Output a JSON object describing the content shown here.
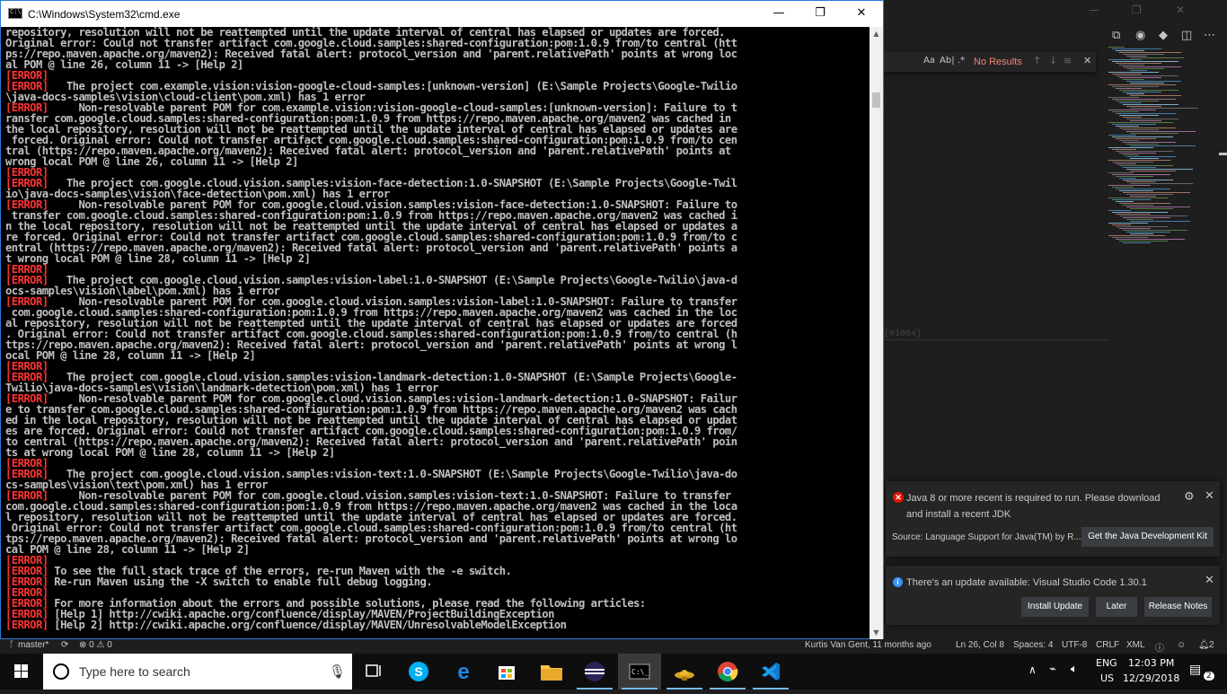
{
  "cmd": {
    "title": "C:\\Windows\\System32\\cmd.exe",
    "minimize": "—",
    "maximize": "❐",
    "close": "✕",
    "lines": [
      {
        "e": "",
        "t": "repository, resolution will not be reattempted until the update interval of central has elapsed or updates are forced."
      },
      {
        "e": "",
        "t": "Original error: Could not transfer artifact com.google.cloud.samples:shared-configuration:pom:1.0.9 from/to central (htt"
      },
      {
        "e": "",
        "t": "ps://repo.maven.apache.org/maven2): Received fatal alert: protocol_version and 'parent.relativePath' points at wrong loc"
      },
      {
        "e": "",
        "t": "al POM @ line 26, column 11 -> [Help 2]"
      },
      {
        "e": "[ERROR]",
        "t": ""
      },
      {
        "e": "[ERROR]",
        "t": "   The project com.example.vision:vision-google-cloud-samples:[unknown-version] (E:\\Sample Projects\\Google-Twilio"
      },
      {
        "e": "",
        "t": "\\java-docs-samples\\vision\\cloud-client\\pom.xml) has 1 error"
      },
      {
        "e": "[ERROR]",
        "t": "     Non-resolvable parent POM for com.example.vision:vision-google-cloud-samples:[unknown-version]: Failure to t"
      },
      {
        "e": "",
        "t": "ransfer com.google.cloud.samples:shared-configuration:pom:1.0.9 from https://repo.maven.apache.org/maven2 was cached in"
      },
      {
        "e": "",
        "t": "the local repository, resolution will not be reattempted until the update interval of central has elapsed or updates are"
      },
      {
        "e": "",
        "t": " forced. Original error: Could not transfer artifact com.google.cloud.samples:shared-configuration:pom:1.0.9 from/to cen"
      },
      {
        "e": "",
        "t": "tral (https://repo.maven.apache.org/maven2): Received fatal alert: protocol_version and 'parent.relativePath' points at"
      },
      {
        "e": "",
        "t": "wrong local POM @ line 26, column 11 -> [Help 2]"
      },
      {
        "e": "[ERROR]",
        "t": ""
      },
      {
        "e": "[ERROR]",
        "t": "   The project com.google.cloud.vision.samples:vision-face-detection:1.0-SNAPSHOT (E:\\Sample Projects\\Google-Twil"
      },
      {
        "e": "",
        "t": "io\\java-docs-samples\\vision\\face-detection\\pom.xml) has 1 error"
      },
      {
        "e": "[ERROR]",
        "t": "     Non-resolvable parent POM for com.google.cloud.vision.samples:vision-face-detection:1.0-SNAPSHOT: Failure to"
      },
      {
        "e": "",
        "t": " transfer com.google.cloud.samples:shared-configuration:pom:1.0.9 from https://repo.maven.apache.org/maven2 was cached i"
      },
      {
        "e": "",
        "t": "n the local repository, resolution will not be reattempted until the update interval of central has elapsed or updates a"
      },
      {
        "e": "",
        "t": "re forced. Original error: Could not transfer artifact com.google.cloud.samples:shared-configuration:pom:1.0.9 from/to c"
      },
      {
        "e": "",
        "t": "entral (https://repo.maven.apache.org/maven2): Received fatal alert: protocol_version and 'parent.relativePath' points a"
      },
      {
        "e": "",
        "t": "t wrong local POM @ line 28, column 11 -> [Help 2]"
      },
      {
        "e": "[ERROR]",
        "t": ""
      },
      {
        "e": "[ERROR]",
        "t": "   The project com.google.cloud.vision.samples:vision-label:1.0-SNAPSHOT (E:\\Sample Projects\\Google-Twilio\\java-d"
      },
      {
        "e": "",
        "t": "ocs-samples\\vision\\label\\pom.xml) has 1 error"
      },
      {
        "e": "[ERROR]",
        "t": "     Non-resolvable parent POM for com.google.cloud.vision.samples:vision-label:1.0-SNAPSHOT: Failure to transfer"
      },
      {
        "e": "",
        "t": " com.google.cloud.samples:shared-configuration:pom:1.0.9 from https://repo.maven.apache.org/maven2 was cached in the loc"
      },
      {
        "e": "",
        "t": "al repository, resolution will not be reattempted until the update interval of central has elapsed or updates are forced"
      },
      {
        "e": "",
        "t": ". Original error: Could not transfer artifact com.google.cloud.samples:shared-configuration:pom:1.0.9 from/to central (h"
      },
      {
        "e": "",
        "t": "ttps://repo.maven.apache.org/maven2): Received fatal alert: protocol_version and 'parent.relativePath' points at wrong l"
      },
      {
        "e": "",
        "t": "ocal POM @ line 28, column 11 -> [Help 2]"
      },
      {
        "e": "[ERROR]",
        "t": ""
      },
      {
        "e": "[ERROR]",
        "t": "   The project com.google.cloud.vision.samples:vision-landmark-detection:1.0-SNAPSHOT (E:\\Sample Projects\\Google-"
      },
      {
        "e": "",
        "t": "Twilio\\java-docs-samples\\vision\\landmark-detection\\pom.xml) has 1 error"
      },
      {
        "e": "[ERROR]",
        "t": "     Non-resolvable parent POM for com.google.cloud.vision.samples:vision-landmark-detection:1.0-SNAPSHOT: Failur"
      },
      {
        "e": "",
        "t": "e to transfer com.google.cloud.samples:shared-configuration:pom:1.0.9 from https://repo.maven.apache.org/maven2 was cach"
      },
      {
        "e": "",
        "t": "ed in the local repository, resolution will not be reattempted until the update interval of central has elapsed or updat"
      },
      {
        "e": "",
        "t": "es are forced. Original error: Could not transfer artifact com.google.cloud.samples:shared-configuration:pom:1.0.9 from/"
      },
      {
        "e": "",
        "t": "to central (https://repo.maven.apache.org/maven2): Received fatal alert: protocol_version and 'parent.relativePath' poin"
      },
      {
        "e": "",
        "t": "ts at wrong local POM @ line 28, column 11 -> [Help 2]"
      },
      {
        "e": "[ERROR]",
        "t": ""
      },
      {
        "e": "[ERROR]",
        "t": "   The project com.google.cloud.vision.samples:vision-text:1.0-SNAPSHOT (E:\\Sample Projects\\Google-Twilio\\java-do"
      },
      {
        "e": "",
        "t": "cs-samples\\vision\\text\\pom.xml) has 1 error"
      },
      {
        "e": "[ERROR]",
        "t": "     Non-resolvable parent POM for com.google.cloud.vision.samples:vision-text:1.0-SNAPSHOT: Failure to transfer"
      },
      {
        "e": "",
        "t": "com.google.cloud.samples:shared-configuration:pom:1.0.9 from https://repo.maven.apache.org/maven2 was cached in the loca"
      },
      {
        "e": "",
        "t": "l repository, resolution will not be reattempted until the update interval of central has elapsed or updates are forced."
      },
      {
        "e": "",
        "t": " Original error: Could not transfer artifact com.google.cloud.samples:shared-configuration:pom:1.0.9 from/to central (ht"
      },
      {
        "e": "",
        "t": "tps://repo.maven.apache.org/maven2): Received fatal alert: protocol_version and 'parent.relativePath' points at wrong lo"
      },
      {
        "e": "",
        "t": "cal POM @ line 28, column 11 -> [Help 2]"
      },
      {
        "e": "[ERROR]",
        "t": ""
      },
      {
        "e": "[ERROR]",
        "t": " To see the full stack trace of the errors, re-run Maven with the -e switch."
      },
      {
        "e": "[ERROR]",
        "t": " Re-run Maven using the -X switch to enable full debug logging."
      },
      {
        "e": "[ERROR]",
        "t": ""
      },
      {
        "e": "[ERROR]",
        "t": " For more information about the errors and possible solutions, please read the following articles:"
      },
      {
        "e": "[ERROR]",
        "t": " [Help 1] http://cwiki.apache.org/confluence/display/MAVEN/ProjectBuildingException"
      },
      {
        "e": "[ERROR]",
        "t": " [Help 2] http://cwiki.apache.org/confluence/display/MAVEN/UnresolvableModelException"
      }
    ]
  },
  "vscode": {
    "window_min": "—",
    "window_max": "❐",
    "window_close": "✕",
    "find": {
      "match_case": "Aa",
      "whole_word": "Ab|",
      "regex": ".*",
      "no_results": "No Results",
      "prev": "↑",
      "next": "↓",
      "selection": "≡",
      "close": "✕"
    },
    "ghost_text": "(#1004)",
    "notifications": {
      "java": {
        "message": "Java 8 or more recent is required to run. Please download and install a recent JDK",
        "source": "Source: Language Support for Java(TM) by R...",
        "button": "Get the Java Development Kit"
      },
      "update": {
        "message": "There's an update available: Visual Studio Code 1.30.1",
        "install": "Install Update",
        "later": "Later",
        "release_notes": "Release Notes"
      }
    },
    "statusbar": {
      "branch": "master*",
      "sync": "⟳",
      "problems": "⊗ 0 ⚠ 0",
      "blame": "Kurtis Van Gent, 11 months ago",
      "position": "Ln 26, Col 8",
      "spaces": "Spaces: 4",
      "encoding": "UTF-8",
      "eol": "CRLF",
      "language": "XML",
      "notifications": "2"
    }
  },
  "taskbar": {
    "search_placeholder": "Type here to search",
    "lang_top": "ENG",
    "lang_bottom": "US",
    "time": "12:03 PM",
    "date": "12/29/2018",
    "notification_count": "2"
  }
}
